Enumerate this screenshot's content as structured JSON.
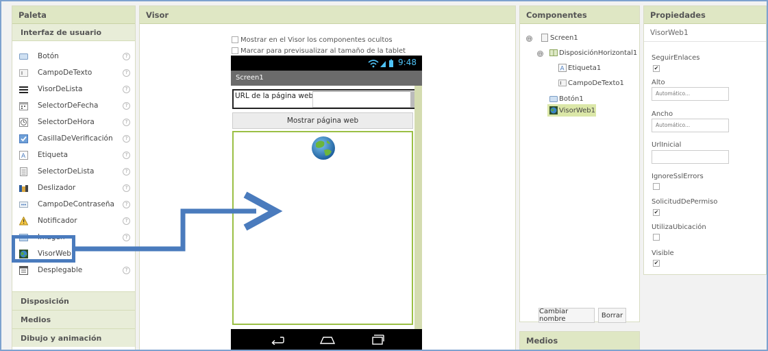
{
  "palette": {
    "header": "Paleta",
    "category_active": "Interfaz de usuario",
    "items": [
      {
        "label": "Botón",
        "icon": "button-icon",
        "help": "?"
      },
      {
        "label": "CampoDeTexto",
        "icon": "textbox-icon",
        "help": "?"
      },
      {
        "label": "VisorDeLista",
        "icon": "listview-icon",
        "help": "?"
      },
      {
        "label": "SelectorDeFecha",
        "icon": "datepicker-icon",
        "help": "?"
      },
      {
        "label": "SelectorDeHora",
        "icon": "timepicker-icon",
        "help": "?"
      },
      {
        "label": "CasillaDeVerificación",
        "icon": "checkbox-icon",
        "help": "?"
      },
      {
        "label": "Etiqueta",
        "icon": "label-icon",
        "help": "?"
      },
      {
        "label": "SelectorDeLista",
        "icon": "listpicker-icon",
        "help": "?"
      },
      {
        "label": "Deslizador",
        "icon": "slider-icon",
        "help": "?"
      },
      {
        "label": "CampoDeContraseña",
        "icon": "password-icon",
        "help": "?"
      },
      {
        "label": "Notificador",
        "icon": "notifier-icon",
        "help": "?"
      },
      {
        "label": "Imagen",
        "icon": "image-icon",
        "help": "?"
      },
      {
        "label": "VisorWeb",
        "icon": "webviewer-icon",
        "help": ""
      },
      {
        "label": "Desplegable",
        "icon": "spinner-icon",
        "help": "?"
      }
    ],
    "categories_bottom": [
      "Disposición",
      "Medios",
      "Dibujo y animación"
    ]
  },
  "viewer": {
    "header": "Visor",
    "option_hidden": "Mostrar en el Visor los componentes ocultos",
    "option_tablet": "Marcar para previsualizar al tamaño de la tablet",
    "phone": {
      "time": "9:48",
      "screen_title": "Screen1",
      "url_label": "URL de la página web",
      "button_label": "Mostrar página web"
    }
  },
  "components": {
    "header": "Componentes",
    "tree": [
      {
        "label": "Screen1",
        "icon": "screen-icon"
      },
      {
        "label": "DisposiciónHorizontal1",
        "icon": "horizontal-arrangement-icon"
      },
      {
        "label": "Etiqueta1",
        "icon": "label-icon"
      },
      {
        "label": "CampoDeTexto1",
        "icon": "textbox-icon"
      },
      {
        "label": "Botón1",
        "icon": "button-icon"
      },
      {
        "label": "VisorWeb1",
        "icon": "webviewer-icon"
      }
    ],
    "toggles": [
      "⊖",
      "⊖"
    ],
    "rename_button": "Cambiar nombre",
    "delete_button": "Borrar",
    "media_header": "Medios"
  },
  "properties": {
    "header": "Propiedades",
    "component": "VisorWeb1",
    "items": [
      {
        "label": "SeguirEnlaces",
        "type": "checkbox",
        "checked": true
      },
      {
        "label": "Alto",
        "type": "text",
        "value": "Automático..."
      },
      {
        "label": "Ancho",
        "type": "text",
        "value": "Automático..."
      },
      {
        "label": "UrlInicial",
        "type": "text",
        "value": ""
      },
      {
        "label": "IgnoreSslErrors",
        "type": "checkbox",
        "checked": false
      },
      {
        "label": "SolicitudDePermiso",
        "type": "checkbox",
        "checked": true
      },
      {
        "label": "UtilizaUbicación",
        "type": "checkbox",
        "checked": false
      },
      {
        "label": "Visible",
        "type": "checkbox",
        "checked": true
      }
    ]
  },
  "colors": {
    "panel_header": "#dfe7c4",
    "highlight": "#4a7bbd",
    "selected": "#dbe7a8"
  }
}
